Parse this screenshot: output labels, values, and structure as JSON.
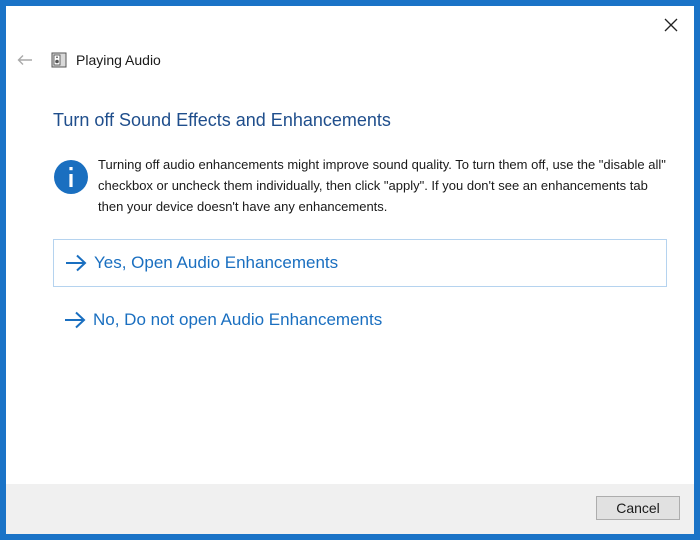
{
  "window": {
    "close_icon": "close-icon"
  },
  "nav": {
    "back_icon": "back-arrow-icon",
    "app_icon": "speaker-icon",
    "title": "Playing Audio"
  },
  "main": {
    "heading": "Turn off Sound Effects and Enhancements",
    "info_icon": "info-icon",
    "info_text": "Turning off audio enhancements might improve sound quality. To turn them off, use the \"disable all\" checkbox or uncheck them individually, then click \"apply\". If you don't see an enhancements tab then your device doesn't have any enhancements.",
    "options": [
      {
        "label": "Yes, Open Audio Enhancements",
        "icon": "right-arrow-icon",
        "selected": true
      },
      {
        "label": "No, Do not open Audio Enhancements",
        "icon": "right-arrow-icon",
        "selected": false
      }
    ]
  },
  "footer": {
    "cancel_label": "Cancel"
  },
  "colors": {
    "accent": "#1a6fc0",
    "heading": "#1f4e8c",
    "frame": "#1a73c7",
    "footer_bg": "#f0f0f0"
  }
}
